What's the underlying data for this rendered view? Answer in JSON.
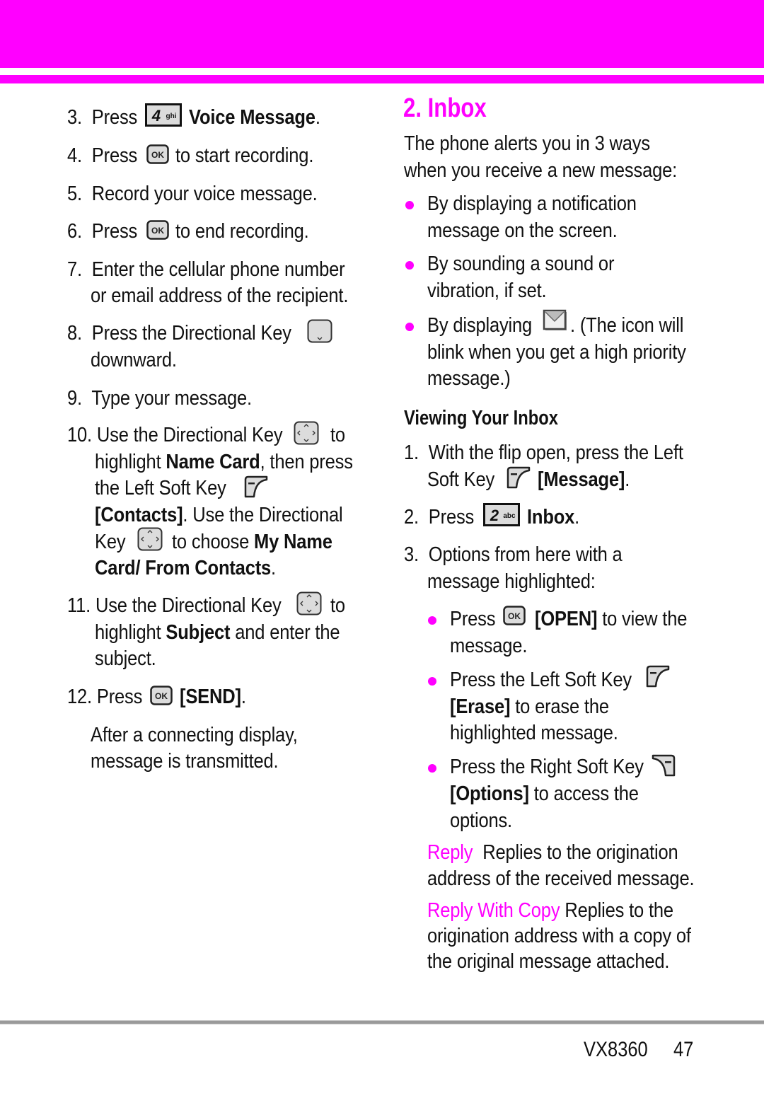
{
  "colors": {
    "accent": "#ff00ff",
    "text": "#111111",
    "rule": "#9a9a9a",
    "key_fill": "#dcdcdc"
  },
  "left_column": {
    "steps": [
      {
        "num": "3.",
        "lines": [
          {
            "pre": "Press",
            "icon": "key-4ghi-icon",
            "bold": "Voice Message",
            "post": "."
          }
        ]
      },
      {
        "num": "4.",
        "lines": [
          {
            "pre": "Press",
            "icon": "ok-key-icon",
            "post": "to start recording."
          }
        ]
      },
      {
        "num": "5.",
        "lines": [
          {
            "pre": "Record your voice message."
          }
        ]
      },
      {
        "num": "6.",
        "lines": [
          {
            "pre": "Press",
            "icon": "ok-key-icon",
            "post": "to end recording."
          }
        ]
      },
      {
        "num": "7.",
        "lines": [
          {
            "pre": "Enter the cellular phone number"
          },
          {
            "pre": "or email address of the recipient."
          }
        ]
      },
      {
        "num": "8.",
        "lines": [
          {
            "pre": "Press the Directional Key",
            "icon": "directional-key-down-icon"
          },
          {
            "pre": "downward."
          }
        ]
      },
      {
        "num": "9.",
        "lines": [
          {
            "pre": "Type your message."
          }
        ]
      },
      {
        "num": "10.",
        "lines": [
          {
            "pre": "Use the Directional Key",
            "icon": "directional-key-icon",
            "post": "to"
          },
          {
            "pre": "highlight ",
            "bold": "Name Card",
            "post": ", then press"
          },
          {
            "pre": "the Left Soft  Key",
            "icon": "left-soft-key-icon"
          },
          {
            "bold": "[Contacts]",
            "post": ". Use the Directional"
          },
          {
            "pre": "Key",
            "icon": "directional-key-icon",
            "post": "to choose ",
            "bold2": "My Name"
          },
          {
            "bold": "Card/ From Contacts",
            "post": "."
          }
        ]
      },
      {
        "num": "11.",
        "lines": [
          {
            "pre": "Use the Directional Key",
            "icon": "directional-key-icon",
            "post": "to"
          },
          {
            "pre": "highlight ",
            "bold": "Subject",
            "post": " and enter the"
          },
          {
            "pre": "subject."
          }
        ]
      },
      {
        "num": "12.",
        "lines": [
          {
            "pre": "Press",
            "icon": "ok-key-icon",
            "bold": "[SEND]",
            "post": "."
          }
        ]
      }
    ],
    "note_lines": [
      "After a connecting display,",
      "message is transmitted."
    ]
  },
  "right_column": {
    "title": "2. Inbox",
    "intro_lines": [
      "The phone alerts you in 3 ways",
      "when you receive a new message:"
    ],
    "alerts": [
      {
        "lines": [
          "By displaying a notification",
          "message  on the screen."
        ]
      },
      {
        "lines": [
          "By sounding a sound or",
          "vibration, if set."
        ]
      },
      {
        "pre": "By displaying",
        "icon": "envelope-icon",
        "post": ". (The icon will",
        "lines": [
          "blink when you get a high priority",
          "message.)"
        ]
      }
    ],
    "subheading": "Viewing Your Inbox",
    "steps": [
      {
        "num": "1.",
        "line1": "With the flip open, press the Left",
        "line2_pre": "Soft Key",
        "line2_icon": "left-soft-key-icon",
        "line2_bold": "[Message]",
        "line2_post": "."
      },
      {
        "num": "2.",
        "pre": "Press",
        "icon": "key-2abc-icon",
        "bold": "Inbox",
        "post": "."
      },
      {
        "num": "3.",
        "line1": "Options from here with a",
        "line2": "message highlighted:"
      }
    ],
    "options": [
      {
        "pre": "Press",
        "icon": "ok-key-icon",
        "bold": "[OPEN]",
        "post": " to view the",
        "lines": [
          "message."
        ]
      },
      {
        "pre": "Press the Left Soft Key",
        "icon": "left-soft-key-icon",
        "bold": "[Erase]",
        "post": " to erase the",
        "lines": [
          "highlighted message."
        ]
      },
      {
        "pre": "Press the Right Soft Key",
        "icon": "right-soft-key-icon",
        "bold": "[Options]",
        "post": " to access the",
        "lines": [
          "options."
        ]
      }
    ],
    "definitions": [
      {
        "term": "Reply",
        "desc1": "Replies to the origination",
        "desc_lines": [
          "address of the received message."
        ]
      },
      {
        "term": "Reply With Copy",
        "desc1": "Replies to the",
        "desc_lines": [
          "origination address with a copy of",
          "the original message attached."
        ]
      }
    ]
  },
  "footer": {
    "model": "VX8360",
    "page": "47"
  }
}
